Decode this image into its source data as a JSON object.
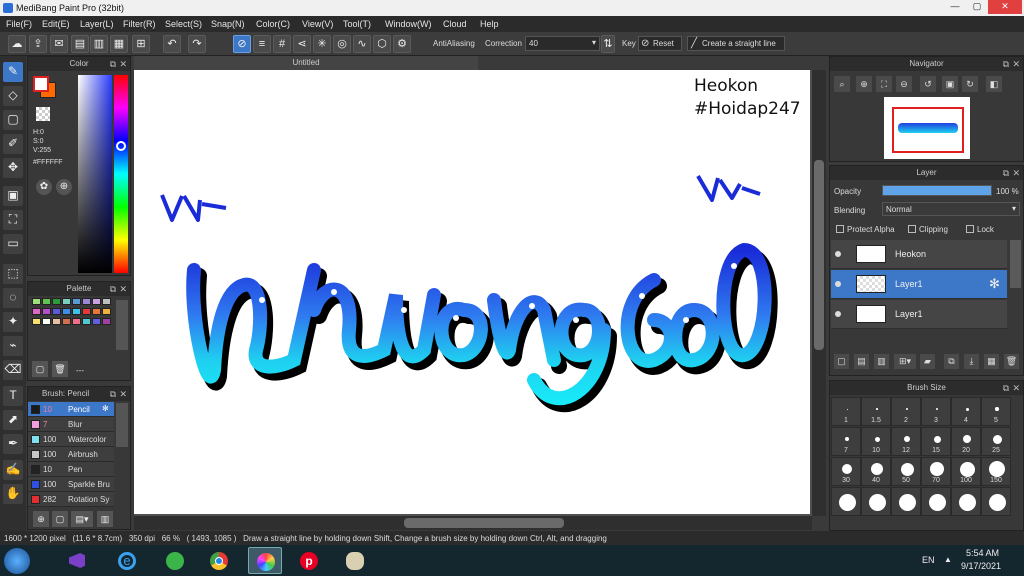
{
  "window": {
    "title": "MediBang Paint Pro (32bit)",
    "min_label": "—",
    "max_label": "▢",
    "close_label": "✕"
  },
  "menu": [
    "File(F)",
    "Edit(E)",
    "Layer(L)",
    "Filter(R)",
    "Select(S)",
    "Snap(N)",
    "Color(C)",
    "View(V)",
    "Tool(T)",
    "Window(W)",
    "Cloud",
    "Help"
  ],
  "toolbar": {
    "antialiasing_label": "AntiAliasing",
    "correction_label": "Correction",
    "correction_value": "40",
    "key_label": "Key",
    "reset_label": "Reset",
    "straight_line_label": "Create a straight line"
  },
  "color_panel": {
    "title": "Color",
    "h": "H:0",
    "s": "S:0",
    "v": "V:255",
    "hex": "#FFFFFF",
    "primary_color": "#ffffff",
    "secondary_color": "#ff6a00"
  },
  "palette_panel": {
    "title": "Palette",
    "more_label": "---",
    "swatches": [
      "#9de07a",
      "#62c254",
      "#2f9a3a",
      "#7acfc0",
      "#5b9bd5",
      "#9b87d8",
      "#c9a0e0",
      "#bfbfbf",
      "#e066c6",
      "#b44fc9",
      "#5a59d6",
      "#3f8ee6",
      "#42c2e6",
      "#e03a3a",
      "#e6763a",
      "#f0b040",
      "#f5e070",
      "#ffffff",
      "#e6c0a0",
      "#d07050",
      "#f06e8c",
      "#50c8d0",
      "#6060e0",
      "#a040a0"
    ]
  },
  "brush_panel": {
    "title": "Brush: Pencil",
    "brushes": [
      {
        "size": "10",
        "name": "Pencil",
        "color": "#1a1a1a"
      },
      {
        "size": "7",
        "name": "Blur",
        "color": "#f0a0e0"
      },
      {
        "size": "100",
        "name": "Watercolor",
        "color": "#80e0f0"
      },
      {
        "size": "100",
        "name": "Airbrush",
        "color": "#c8c8c8"
      },
      {
        "size": "10",
        "name": "Pen",
        "color": "#222222"
      },
      {
        "size": "100",
        "name": "Sparkle Bru",
        "color": "#3050e0"
      },
      {
        "size": "282",
        "name": "Rotation Sy",
        "color": "#e03030"
      }
    ]
  },
  "canvas": {
    "tab_title": "Untitled",
    "watermark_line1": "Heokon",
    "watermark_line2": "#Hoidap247"
  },
  "navigator": {
    "title": "Navigator"
  },
  "layer_panel": {
    "title": "Layer",
    "opacity_label": "Opacity",
    "opacity_value": "100 %",
    "opacity_fraction": 1.0,
    "blending_label": "Blending",
    "blending_value": "Normal",
    "protect_alpha_label": "Protect Alpha",
    "clipping_label": "Clipping",
    "lock_label": "Lock",
    "layers": [
      {
        "name": "Heokon",
        "selected": false
      },
      {
        "name": "Layer1",
        "selected": true
      },
      {
        "name": "Layer1",
        "selected": false
      }
    ]
  },
  "brush_size_panel": {
    "title": "Brush Size",
    "sizes": [
      "1",
      "1.5",
      "2",
      "3",
      "4",
      "5",
      "7",
      "10",
      "12",
      "15",
      "20",
      "25",
      "30",
      "40",
      "50",
      "70",
      "100",
      "150",
      "",
      "",
      "",
      "",
      "",
      ""
    ]
  },
  "status": {
    "text": "1600 * 1200 pixel   (11.6 * 8.7cm)   350 dpi   66 %   ( 1493, 1085 )   Draw a straight line by holding down Shift, Change a brush size by holding down Ctrl, Alt, and dragging"
  },
  "taskbar": {
    "lang": "EN",
    "time": "5:54 AM",
    "date": "9/17/2021"
  }
}
